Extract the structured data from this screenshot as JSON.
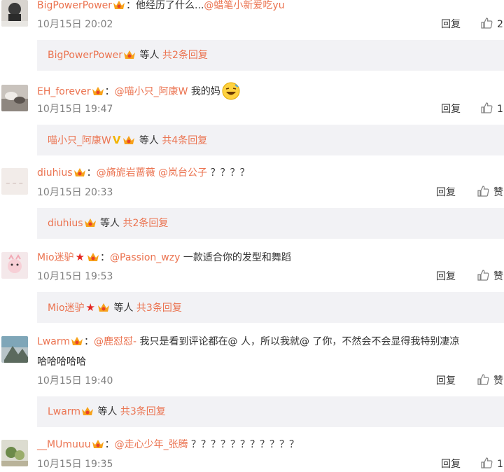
{
  "comments": [
    {
      "user": "BigPowerPower",
      "colon": "：",
      "parts": [
        "他经历了什么...",
        "@蜡笔小新爱吃yu"
      ],
      "time": "10月15日 20:02",
      "reply": "回复",
      "likes": "2",
      "sub": {
        "user": "BigPowerPower",
        "middle": "等人",
        "link": "共2条回复"
      }
    },
    {
      "user": "EH_forever",
      "colon": "：",
      "parts": [
        "@喵小只_阿康W",
        " 我的妈"
      ],
      "emoji": "laughing-emoji-icon",
      "time": "10月15日 19:47",
      "reply": "回复",
      "likes": "1",
      "sub": {
        "user": "喵小只_阿康W",
        "badge": "V",
        "middle": "等人",
        "link": "共4条回复"
      }
    },
    {
      "user": "diuhius",
      "colon": "：",
      "parts": [
        "@旖旎岩蔷薇",
        "@岚台公子",
        "？？？？"
      ],
      "time": "10月15日 20:33",
      "reply": "回复",
      "likes": "赞",
      "sub": {
        "user": "diuhius",
        "middle": "等人",
        "link": "共2条回复"
      }
    },
    {
      "user": "Mio迷驴",
      "colon": "：",
      "parts": [
        "@Passion_wzy",
        " 一款适合你的发型和舞蹈"
      ],
      "time": "10月15日 19:53",
      "reply": "回复",
      "likes": "赞",
      "sub": {
        "user": "Mio迷驴",
        "middle": "等人",
        "link": "共3条回复"
      }
    },
    {
      "user": "Lwarm",
      "colon": "：",
      "parts": [
        "@鹿怼怼-",
        " 我只是看到评论都在@ 人，所以我就@ 了你，不然会不会显得我特别凄凉"
      ],
      "line2": "哈哈哈哈哈",
      "time": "10月15日 19:40",
      "reply": "回复",
      "likes": "赞",
      "sub": {
        "user": "Lwarm",
        "middle": "等人",
        "link": "共3条回复"
      }
    },
    {
      "user": "__MUmuuu",
      "colon": "：",
      "parts": [
        "@走心少年_张腾",
        " ？？？？？？？？？？？"
      ],
      "time": "10月15日 19:35",
      "reply": "回复",
      "likes": "1"
    }
  ]
}
